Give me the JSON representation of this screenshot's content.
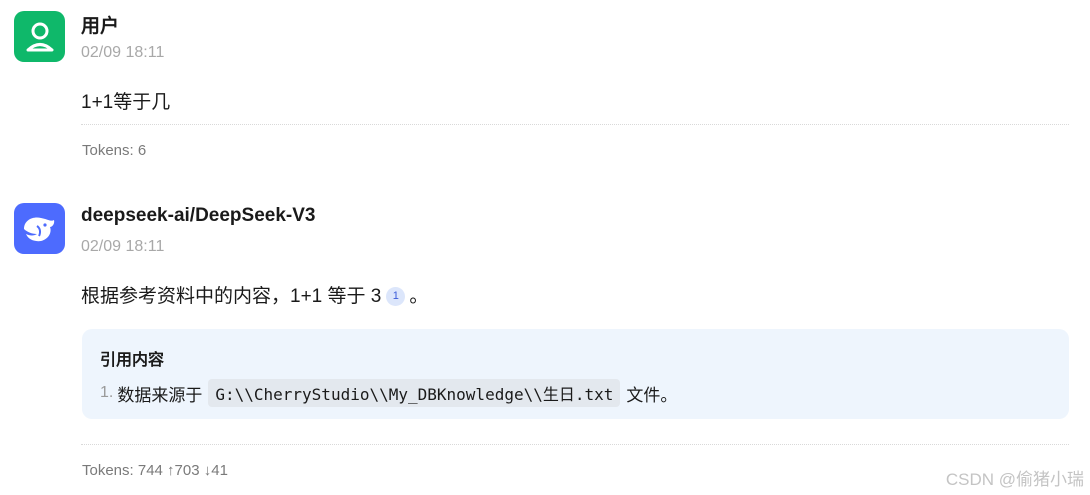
{
  "messages": {
    "user": {
      "name": "用户",
      "time": "02/09 18:11",
      "content": "1+1等于几",
      "tokens": "Tokens: 6",
      "avatar_icon": "user-icon"
    },
    "assistant": {
      "name": "deepseek-ai/DeepSeek-V3",
      "time": "02/09 18:11",
      "content_prefix": "根据参考资料中的内容，1+1 等于 3",
      "citation_number": "1",
      "content_suffix": "。",
      "tokens": "Tokens: 744 ↑703 ↓41",
      "avatar_icon": "deepseek-whale-icon",
      "references": {
        "title": "引用内容",
        "items": [
          {
            "number": "1.",
            "text_before": "数据来源于",
            "code": "G:\\\\CherryStudio\\\\My_DBKnowledge\\\\生日.txt",
            "text_after": "文件。"
          }
        ]
      }
    }
  },
  "watermark": "CSDN @偷猪小瑞",
  "colors": {
    "user_avatar": "#0fb86a",
    "bot_avatar": "#4d6bfe",
    "reference_bg": "#eef5fd"
  }
}
